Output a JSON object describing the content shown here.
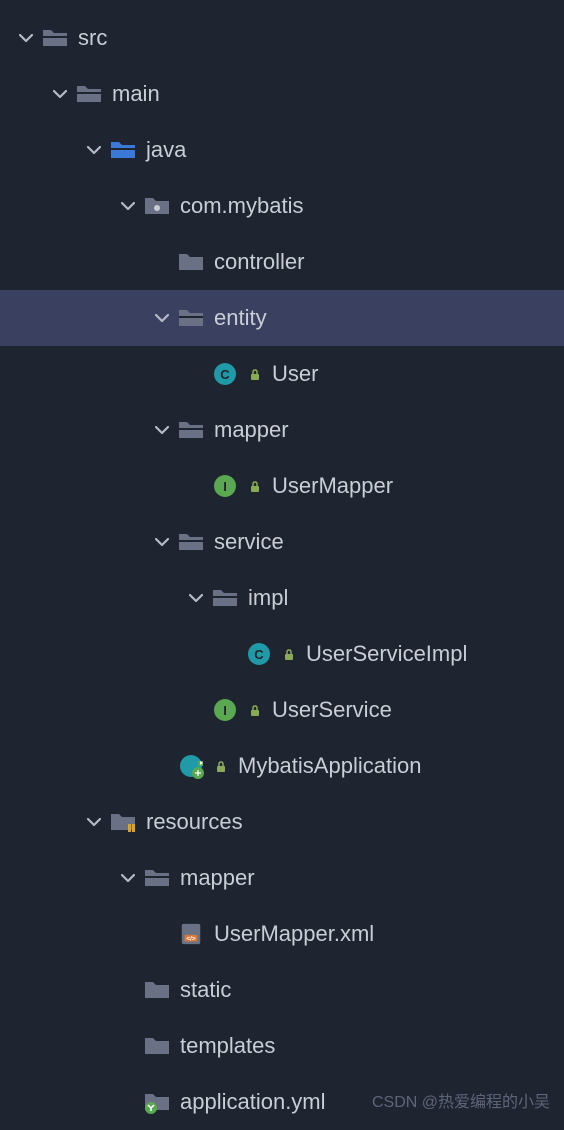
{
  "tree": {
    "src": {
      "label": "src"
    },
    "main": {
      "label": "main"
    },
    "java": {
      "label": "java"
    },
    "pkg": {
      "label": "com.mybatis"
    },
    "controller": {
      "label": "controller"
    },
    "entity": {
      "label": "entity"
    },
    "user_class": {
      "label": "User"
    },
    "mapper_pkg": {
      "label": "mapper"
    },
    "user_mapper": {
      "label": "UserMapper"
    },
    "service": {
      "label": "service"
    },
    "impl": {
      "label": "impl"
    },
    "user_service_impl": {
      "label": "UserServiceImpl"
    },
    "user_service": {
      "label": "UserService"
    },
    "app": {
      "label": "MybatisApplication"
    },
    "resources": {
      "label": "resources"
    },
    "res_mapper": {
      "label": "mapper"
    },
    "user_mapper_xml": {
      "label": "UserMapper.xml"
    },
    "static": {
      "label": "static"
    },
    "templates": {
      "label": "templates"
    },
    "app_yml": {
      "label": "application.yml"
    }
  },
  "watermark": "CSDN @热爱编程的小吴"
}
